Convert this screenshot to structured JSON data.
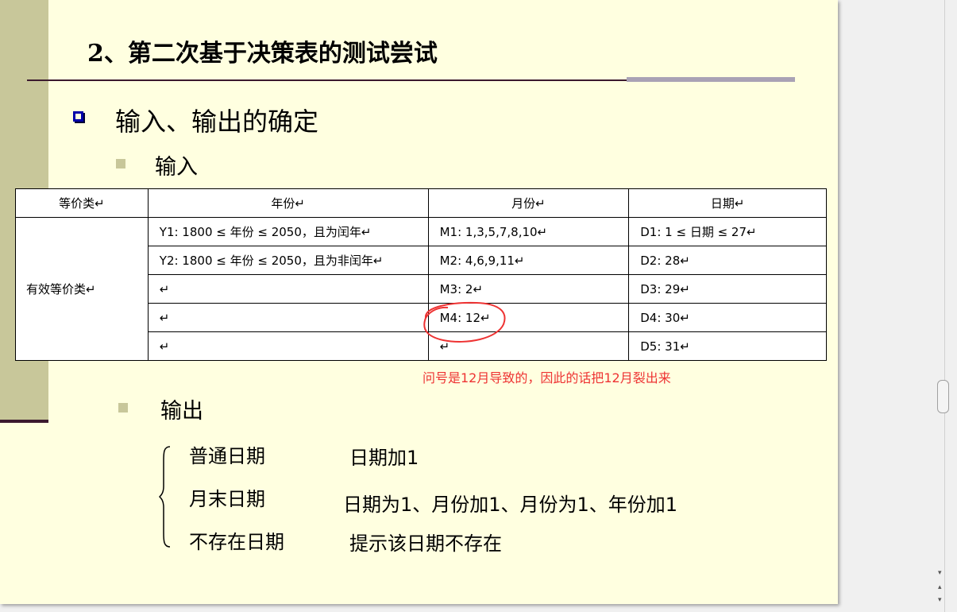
{
  "slide": {
    "title": "2、第二次基于决策表的测试尝试",
    "heading1": "输入、输出的确定",
    "input_label": "输入",
    "output_label": "输出",
    "table": {
      "headers": [
        "等价类↵",
        "年份↵",
        "月份↵",
        "日期↵"
      ],
      "class_label": "有效等价类↵",
      "rows": [
        [
          "Y1: 1800 ≤ 年份 ≤ 2050，且为闰年↵",
          "M1: 1,3,5,7,8,10↵",
          "D1: 1 ≤ 日期 ≤ 27↵"
        ],
        [
          "Y2: 1800 ≤ 年份 ≤ 2050，且为非闰年↵",
          "M2: 4,6,9,11↵",
          "D2: 28↵"
        ],
        [
          "↵",
          "M3: 2↵",
          "D3: 29↵"
        ],
        [
          "↵",
          "M4: 12↵",
          "D4: 30↵"
        ],
        [
          "↵",
          "↵",
          "D5: 31↵"
        ]
      ]
    },
    "annotation": "问号是12月导致的，因此的话把12月裂出来",
    "outputs": [
      {
        "name": "普通日期",
        "action": "日期加1"
      },
      {
        "name": "月末日期",
        "action": "日期为1、月份加1、月份为1、年份加1"
      },
      {
        "name": "不存在日期",
        "action": "提示该日期不存在"
      }
    ]
  },
  "colors": {
    "background": "#ffffe0",
    "accent_bar": "#c8c79a",
    "bullet": "#0000aa",
    "annotation": "#ee3333"
  },
  "icons": {
    "bullet": "hollow-square-icon",
    "sub_bullet": "filled-square-icon",
    "scroll_up": "triangle-up-icon",
    "scroll_down": "triangle-down-icon"
  }
}
